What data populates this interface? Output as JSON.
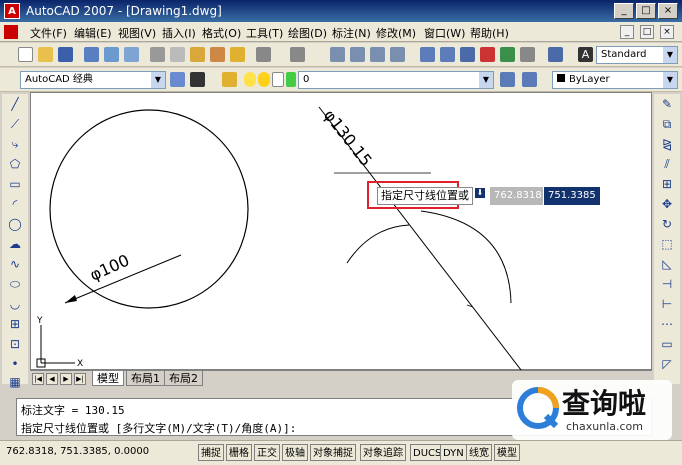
{
  "window": {
    "title": "AutoCAD 2007 - [Drawing1.dwg]",
    "app_icon_letter": "A"
  },
  "window_controls": [
    "_",
    "□",
    "×"
  ],
  "mdi_controls": [
    "_",
    "□",
    "×"
  ],
  "menu": [
    "文件(F)",
    "编辑(E)",
    "视图(V)",
    "插入(I)",
    "格式(O)",
    "工具(T)",
    "绘图(D)",
    "标注(N)",
    "修改(M)",
    "窗口(W)",
    "帮助(H)"
  ],
  "toolbar": {
    "text_style": "Standard",
    "workspace": "AutoCAD 经典",
    "layer": "0",
    "linetype": "ByLayer"
  },
  "drawing": {
    "circle_dim": "φ100",
    "line_dim": "φ130.15",
    "prompt": "指定尺寸线位置或",
    "coord_x": "762.8318",
    "coord_y": "751.3385",
    "ucs_x": "X",
    "ucs_y": "Y"
  },
  "tabs": [
    "模型",
    "布局1",
    "布局2"
  ],
  "tab_nav": [
    "|◀",
    "◀",
    "▶",
    "▶|"
  ],
  "command": {
    "line1": "标注文字 = 130.15",
    "line2": "指定尺寸线位置或 [多行文字(M)/文字(T)/角度(A)]:"
  },
  "status": {
    "coords": "762.8318,  751.3385,  0.0000",
    "buttons": [
      "捕捉",
      "栅格",
      "正交",
      "极轴",
      "对象捕捉",
      "对象追踪",
      "DUCS",
      "DYN",
      "线宽",
      "模型"
    ]
  },
  "watermark": {
    "name": "查询啦",
    "url": "chaxunla.com"
  },
  "colors": {
    "accent": "#0a246a",
    "highlight_box": "#e0202a",
    "dyn_value_bg": "#12326e"
  }
}
